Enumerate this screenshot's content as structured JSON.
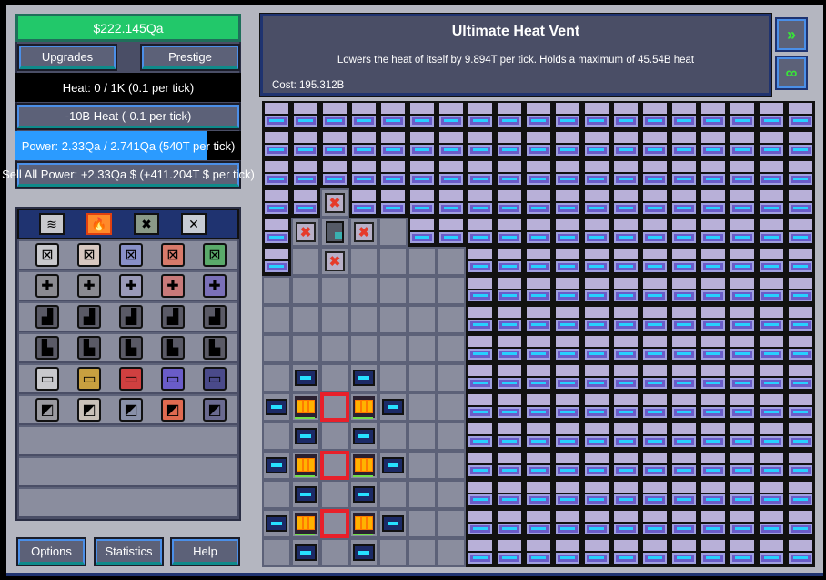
{
  "money": "$222.145Qa",
  "buttons": {
    "upgrades": "Upgrades",
    "prestige": "Prestige",
    "reduce_heat": "-10B Heat (-0.1 per tick)",
    "sell_power": "Sell All Power: +2.33Qa $ (+411.204T $ per tick)",
    "options": "Options",
    "statistics": "Statistics",
    "help": "Help"
  },
  "heat": {
    "text": "Heat: 0 / 1K (0.1 per tick)",
    "fraction": 0
  },
  "power": {
    "text": "Power: 2.33Qa / 2.741Qa (540T per tick)",
    "fraction": 0.85,
    "color": "#2b9bff"
  },
  "parts_tabs": [
    {
      "name": "power-tab",
      "icon": "≋",
      "selected": false
    },
    {
      "name": "heat-tab",
      "icon": "🔥",
      "selected": true
    },
    {
      "name": "experimental-tab",
      "icon": "✖",
      "selected": false
    },
    {
      "name": "misc-tab",
      "icon": "✕",
      "selected": false
    }
  ],
  "parts_rows": [
    {
      "name": "vents",
      "colors": [
        "#c8c8cc",
        "#d8c8c0",
        "#8890c8",
        "#d87a6a",
        "#5aaa6a"
      ],
      "glyph": "⊠"
    },
    {
      "name": "heat-exchangers",
      "colors": [
        "#8a8a90",
        "#8a8a90",
        "#9a9ab8",
        "#c87a7a",
        "#7a70b8"
      ],
      "glyph": "✚"
    },
    {
      "name": "heat-inlets",
      "colors": [
        "#5a5a66",
        "#5a5a66",
        "#5a5a66",
        "#5a5a66",
        "#5a5a66"
      ],
      "glyph": "▟"
    },
    {
      "name": "heat-outlets",
      "colors": [
        "#5a5a66",
        "#5a5a66",
        "#5a5a66",
        "#5a5a66",
        "#5a5a66"
      ],
      "glyph": "▙"
    },
    {
      "name": "coolant-cells",
      "colors": [
        "#c8c8cc",
        "#c8a040",
        "#d04040",
        "#6a5cc8",
        "#4a4a8a"
      ],
      "glyph": "▭"
    },
    {
      "name": "reactor-platings",
      "colors": [
        "#9a9aa0",
        "#c8c0b8",
        "#8890a8",
        "#e06a50",
        "#6a6a90"
      ],
      "glyph": "◩"
    }
  ],
  "component": {
    "title": "Ultimate Heat Vent",
    "description": "Lowers the heat of itself by 9.894T per tick. Holds a maximum of 45.54B heat",
    "cost": "Cost: 195.312B"
  },
  "side_buttons": [
    {
      "name": "pause-speed-button",
      "icon": "»"
    },
    {
      "name": "infinite-button",
      "icon": "∞"
    }
  ],
  "reactor_grid": {
    "cols": 19,
    "rows": 16,
    "legend": {
      "V": "vent",
      ".": "empty",
      "C": "coolant-vent",
      "X": "capacitor-part",
      "E": "heat-exchanger",
      "F": "fuel-cell",
      "R": "selected-empty"
    },
    "layout": [
      "VVVVVVVVVVVVVVVVVVV",
      "VVVVVVVVVVVVVVVVVVV",
      "VVVVVVVVVVVVVVVVVVV",
      "VVCVVVVVVVVVVVVVVVV",
      "VCXC.VVVVVVVVVVVVVV",
      "V.C....VVVVVVVVVVVV",
      ".......VVVVVVVVVVVV",
      ".......VVVVVVVVVVVV",
      ".......VVVVVVVVVVVV",
      ".E.E...VVVVVVVVVVVV",
      "EFRFE..VVVVVVVVVVVV",
      ".E.E...VVVVVVVVVVVV",
      "EFRFE..VVVVVVVVVVVV",
      ".E.E...VVVVVVVVVVVV",
      "EFRFE..VVVVVVVVVVVV",
      ".E.E...VVVVVVVVVVVV"
    ]
  }
}
